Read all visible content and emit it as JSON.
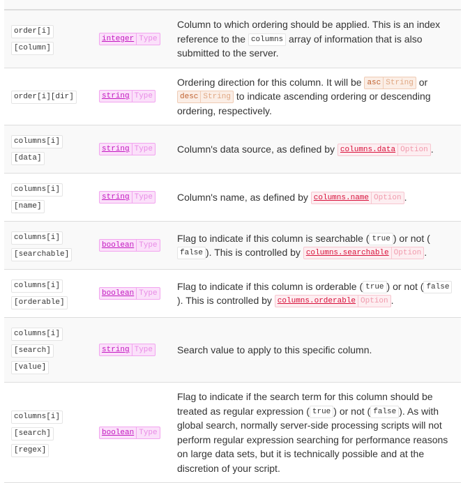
{
  "colors": {
    "type_chip": "#c217bf",
    "option_chip": "#d8103a",
    "string_chip": "#c0612e",
    "row_alt": "#f9f9f9"
  },
  "rows": [
    {
      "param": [
        "order[i]",
        "[column]"
      ],
      "type": {
        "value": "integer",
        "label": "Type"
      },
      "desc": [
        {
          "t": "Column to which ordering should be applied. This is an index reference to the "
        },
        {
          "code": "columns"
        },
        {
          "t": " array of information that is also submitted to the server."
        }
      ]
    },
    {
      "param": [
        "order[i][dir]"
      ],
      "type": {
        "value": "string",
        "label": "Type"
      },
      "desc": [
        {
          "t": "Ordering direction for this column. It will be "
        },
        {
          "chip": "asc",
          "label": "String",
          "kind": "str"
        },
        {
          "t": " or "
        },
        {
          "chip": "desc",
          "label": "String",
          "kind": "str"
        },
        {
          "t": " to indicate ascending ordering or descending ordering, respectively."
        }
      ]
    },
    {
      "param": [
        "columns[i]",
        "[data]"
      ],
      "type": {
        "value": "string",
        "label": "Type"
      },
      "desc": [
        {
          "t": "Column's data source, as defined by "
        },
        {
          "chip": "columns.data",
          "label": "Option",
          "kind": "opt"
        },
        {
          "t": "."
        }
      ]
    },
    {
      "param": [
        "columns[i]",
        "[name]"
      ],
      "type": {
        "value": "string",
        "label": "Type"
      },
      "desc": [
        {
          "t": "Column's name, as defined by "
        },
        {
          "chip": "columns.name",
          "label": "Option",
          "kind": "opt"
        },
        {
          "t": "."
        }
      ]
    },
    {
      "param": [
        "columns[i]",
        "[searchable]"
      ],
      "type": {
        "value": "boolean",
        "label": "Type"
      },
      "desc": [
        {
          "t": "Flag to indicate if this column is searchable ("
        },
        {
          "code": "true"
        },
        {
          "t": ") or not ("
        },
        {
          "code": "false"
        },
        {
          "t": "). This is controlled by "
        },
        {
          "chip": "columns.searchable",
          "label": "Option",
          "kind": "opt"
        },
        {
          "t": "."
        }
      ]
    },
    {
      "param": [
        "columns[i]",
        "[orderable]"
      ],
      "type": {
        "value": "boolean",
        "label": "Type"
      },
      "desc": [
        {
          "t": "Flag to indicate if this column is orderable ("
        },
        {
          "code": "true"
        },
        {
          "t": ") or not ("
        },
        {
          "code": "false"
        },
        {
          "t": "). This is controlled by "
        },
        {
          "chip": "columns.orderable",
          "label": "Option",
          "kind": "opt"
        },
        {
          "t": "."
        }
      ]
    },
    {
      "param": [
        "columns[i]",
        "[search]",
        "[value]"
      ],
      "type": {
        "value": "string",
        "label": "Type"
      },
      "desc": [
        {
          "t": "Search value to apply to this specific column."
        }
      ]
    },
    {
      "param": [
        "columns[i]",
        "[search]",
        "[regex]"
      ],
      "type": {
        "value": "boolean",
        "label": "Type"
      },
      "desc": [
        {
          "t": "Flag to indicate if the search term for this column should be treated as regular expression ("
        },
        {
          "code": "true"
        },
        {
          "t": ") or not ("
        },
        {
          "code": "false"
        },
        {
          "t": "). As with global search, normally server-side processing scripts will not perform regular expression searching for performance reasons on large data sets, but it is technically possible and at the discretion of your script."
        }
      ]
    }
  ]
}
